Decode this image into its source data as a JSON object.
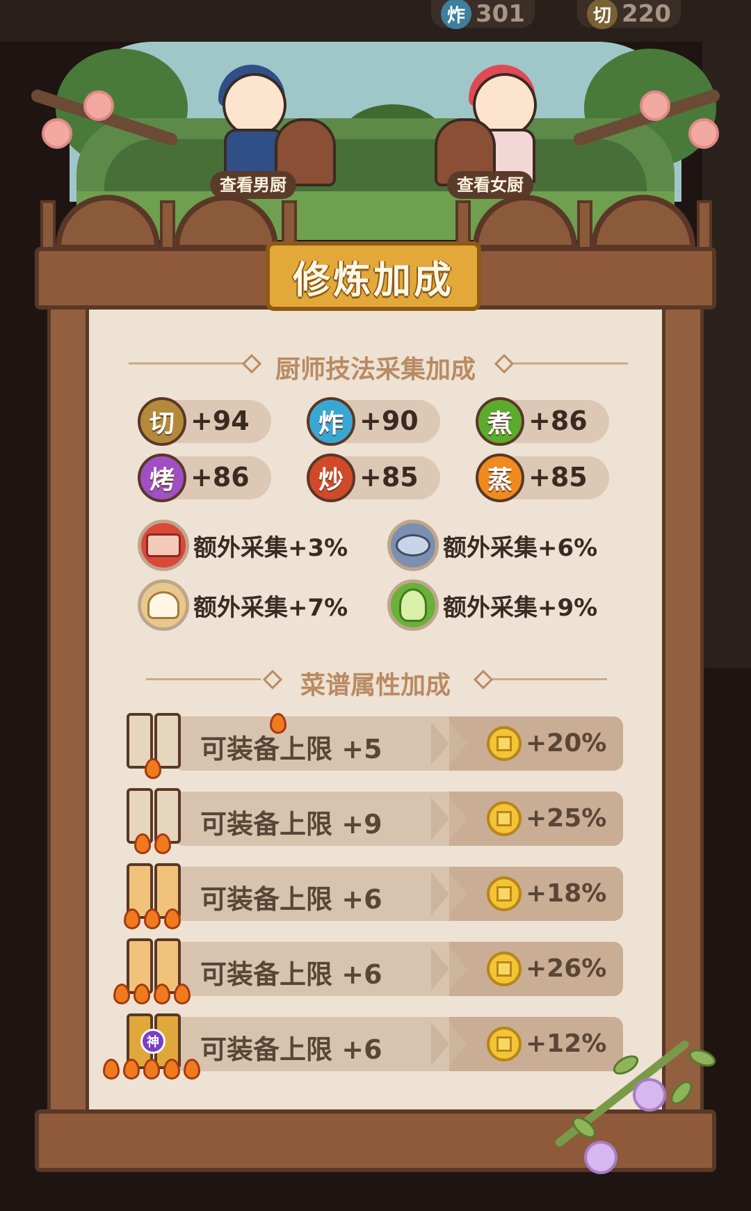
{
  "background_chips": [
    {
      "icon_char": "炸",
      "value": "301",
      "color": "#3d7f9c"
    },
    {
      "icon_char": "切",
      "value": "220",
      "color": "#7a6134"
    }
  ],
  "chef_buttons": {
    "male": "查看男厨",
    "female": "查看女厨"
  },
  "title": "修炼加成",
  "skill_section": {
    "title": "厨师技法采集加成",
    "skills": [
      {
        "char": "切",
        "value": "+94",
        "color": "#b48a3a"
      },
      {
        "char": "炸",
        "value": "+90",
        "color": "#3aa6d4"
      },
      {
        "char": "煮",
        "value": "+86",
        "color": "#5cab2c"
      },
      {
        "char": "烤",
        "value": "+86",
        "color": "#a04fc4"
      },
      {
        "char": "炒",
        "value": "+85",
        "color": "#d04a2a"
      },
      {
        "char": "蒸",
        "value": "+85",
        "color": "#f08a1e"
      }
    ],
    "extras": [
      {
        "icon": "meat-icon",
        "text": "额外采集+3%"
      },
      {
        "icon": "fish-icon",
        "text": "额外采集+6%"
      },
      {
        "icon": "flour-icon",
        "text": "额外采集+7%"
      },
      {
        "icon": "vegetable-icon",
        "text": "额外采集+9%"
      }
    ]
  },
  "recipe_section": {
    "title": "菜谱属性加成",
    "rows": [
      {
        "label": "可装备上限 +5",
        "bonus": "+20%",
        "flames": 1,
        "tier": "plain"
      },
      {
        "label": "可装备上限 +9",
        "bonus": "+25%",
        "flames": 2,
        "tier": "plain"
      },
      {
        "label": "可装备上限 +6",
        "bonus": "+18%",
        "flames": 3,
        "tier": "red"
      },
      {
        "label": "可装备上限 +6",
        "bonus": "+26%",
        "flames": 4,
        "tier": "red"
      },
      {
        "label": "可装备上限 +6",
        "bonus": "+12%",
        "flames": 5,
        "tier": "divine",
        "badge": "神"
      }
    ]
  }
}
